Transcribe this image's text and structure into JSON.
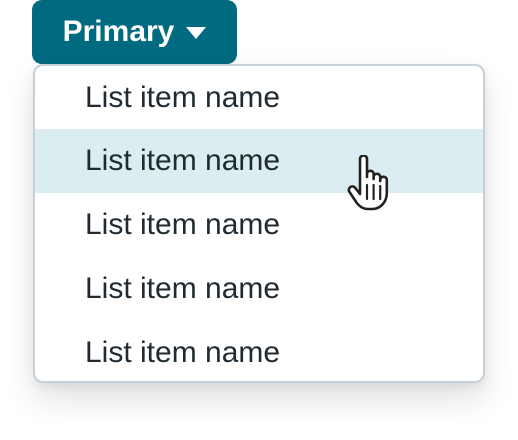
{
  "button": {
    "label": "Primary",
    "icon": "caret-down-icon",
    "color": "#006a80"
  },
  "menu": {
    "items": [
      {
        "label": "List item name"
      },
      {
        "label": "List item name"
      },
      {
        "label": "List item name"
      },
      {
        "label": "List item name"
      },
      {
        "label": "List item name"
      }
    ],
    "hover_color": "#dcedf2"
  },
  "cursor": {
    "icon": "pointer-hand-icon"
  }
}
